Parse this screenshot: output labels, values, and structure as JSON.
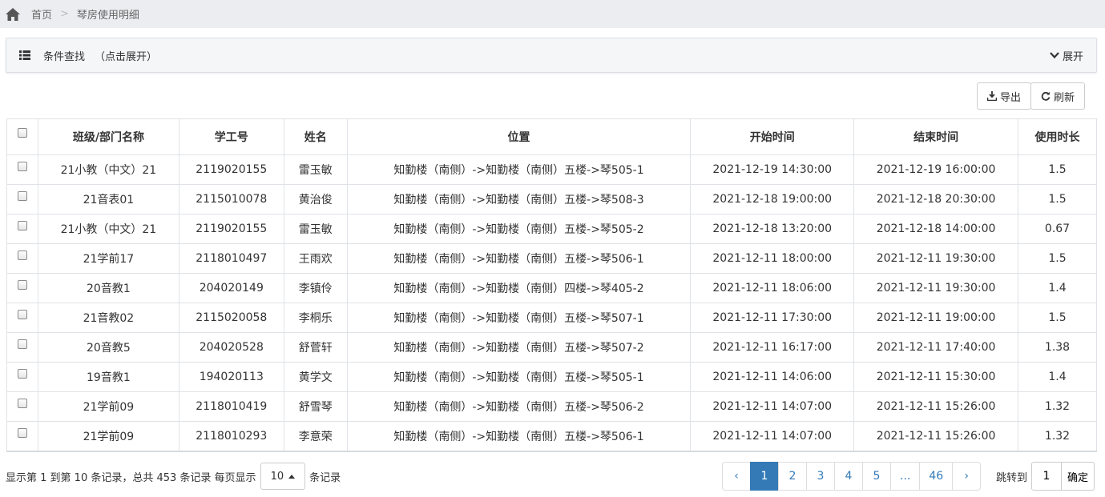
{
  "breadcrumb": {
    "home": "首页",
    "separator": ">",
    "current": "琴房使用明细"
  },
  "filter": {
    "title": "条件查找",
    "hint": "（点击展开）",
    "expand_label": "展开"
  },
  "toolbar": {
    "export_label": "导出",
    "refresh_label": "刷新"
  },
  "table": {
    "headers": [
      "班级/部门名称",
      "学工号",
      "姓名",
      "位置",
      "开始时间",
      "结束时间",
      "使用时长"
    ],
    "rows": [
      [
        "21小教（中文）21",
        "2119020155",
        "雷玉敏",
        "知勤楼（南侧）->知勤楼（南侧）五楼->琴505-1",
        "2021-12-19 14:30:00",
        "2021-12-19 16:00:00",
        "1.5"
      ],
      [
        "21音表01",
        "2115010078",
        "黄治俊",
        "知勤楼（南侧）->知勤楼（南侧）五楼->琴508-3",
        "2021-12-18 19:00:00",
        "2021-12-18 20:30:00",
        "1.5"
      ],
      [
        "21小教（中文）21",
        "2119020155",
        "雷玉敏",
        "知勤楼（南侧）->知勤楼（南侧）五楼->琴505-2",
        "2021-12-18 13:20:00",
        "2021-12-18 14:00:00",
        "0.67"
      ],
      [
        "21学前17",
        "2118010497",
        "王雨欢",
        "知勤楼（南侧）->知勤楼（南侧）五楼->琴506-1",
        "2021-12-11 18:00:00",
        "2021-12-11 19:30:00",
        "1.5"
      ],
      [
        "20音教1",
        "204020149",
        "李镇伶",
        "知勤楼（南侧）->知勤楼（南侧）四楼->琴405-2",
        "2021-12-11 18:06:00",
        "2021-12-11 19:30:00",
        "1.4"
      ],
      [
        "21音教02",
        "2115020058",
        "李桐乐",
        "知勤楼（南侧）->知勤楼（南侧）五楼->琴507-1",
        "2021-12-11 17:30:00",
        "2021-12-11 19:00:00",
        "1.5"
      ],
      [
        "20音教5",
        "204020528",
        "舒菅轩",
        "知勤楼（南侧）->知勤楼（南侧）五楼->琴507-2",
        "2021-12-11 16:17:00",
        "2021-12-11 17:40:00",
        "1.38"
      ],
      [
        "19音教1",
        "194020113",
        "黄学文",
        "知勤楼（南侧）->知勤楼（南侧）五楼->琴505-1",
        "2021-12-11 14:06:00",
        "2021-12-11 15:30:00",
        "1.4"
      ],
      [
        "21学前09",
        "2118010419",
        "舒雪琴",
        "知勤楼（南侧）->知勤楼（南侧）五楼->琴506-2",
        "2021-12-11 14:07:00",
        "2021-12-11 15:26:00",
        "1.32"
      ],
      [
        "21学前09",
        "2118010293",
        "李意荣",
        "知勤楼（南侧）->知勤楼（南侧）五楼->琴506-1",
        "2021-12-11 14:07:00",
        "2021-12-11 15:26:00",
        "1.32"
      ]
    ]
  },
  "footer": {
    "summary": "显示第 1 到第 10 条记录，总共 453 条记录 每页显示",
    "page_size": "10",
    "suffix": "条记录",
    "pages": [
      "‹",
      "1",
      "2",
      "3",
      "4",
      "5",
      "...",
      "46",
      "›"
    ],
    "active_page": "1",
    "jump_label": "跳转到",
    "jump_value": "1",
    "confirm_label": "确定"
  },
  "colors": {
    "accent": "#337ab7",
    "breadcrumb_bg": "#ebedf1",
    "panel_bg": "#f5f6f8"
  }
}
